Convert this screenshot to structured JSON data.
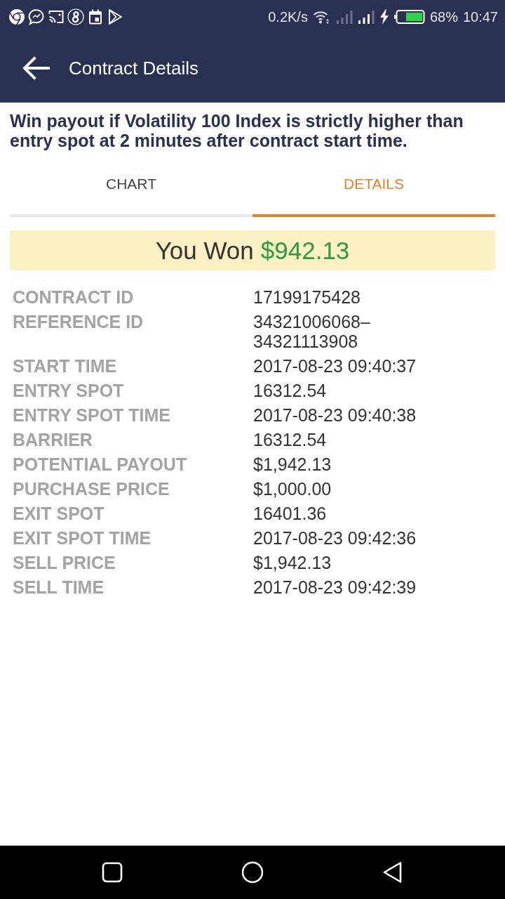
{
  "status_bar": {
    "network_speed": "0.2K/s",
    "battery": "68%",
    "time": "10:47"
  },
  "app_bar": {
    "title": "Contract Details"
  },
  "description": "Win payout if Volatility 100 Index is strictly higher than entry spot at 2 minutes after contract start time.",
  "tabs": [
    {
      "label": "CHART",
      "selected": false
    },
    {
      "label": "DETAILS",
      "selected": true
    }
  ],
  "result": {
    "label": "You Won",
    "amount": "$942.13"
  },
  "details": [
    {
      "label": "CONTRACT ID",
      "value": "17199175428"
    },
    {
      "label": "REFERENCE ID",
      "value": "34321006068–34321113908"
    },
    {
      "label": "START TIME",
      "value": "2017-08-23 09:40:37"
    },
    {
      "label": "ENTRY SPOT",
      "value": "16312.54"
    },
    {
      "label": "ENTRY SPOT TIME",
      "value": "2017-08-23 09:40:38"
    },
    {
      "label": "BARRIER",
      "value": "16312.54"
    },
    {
      "label": "POTENTIAL PAYOUT",
      "value": "$1,942.13"
    },
    {
      "label": "PURCHASE PRICE",
      "value": "$1,000.00"
    },
    {
      "label": "EXIT SPOT",
      "value": "16401.36"
    },
    {
      "label": "EXIT SPOT TIME",
      "value": "2017-08-23 09:42:36"
    },
    {
      "label": "SELL PRICE",
      "value": "$1,942.13"
    },
    {
      "label": "SELL TIME",
      "value": "2017-08-23 09:42:39"
    }
  ]
}
